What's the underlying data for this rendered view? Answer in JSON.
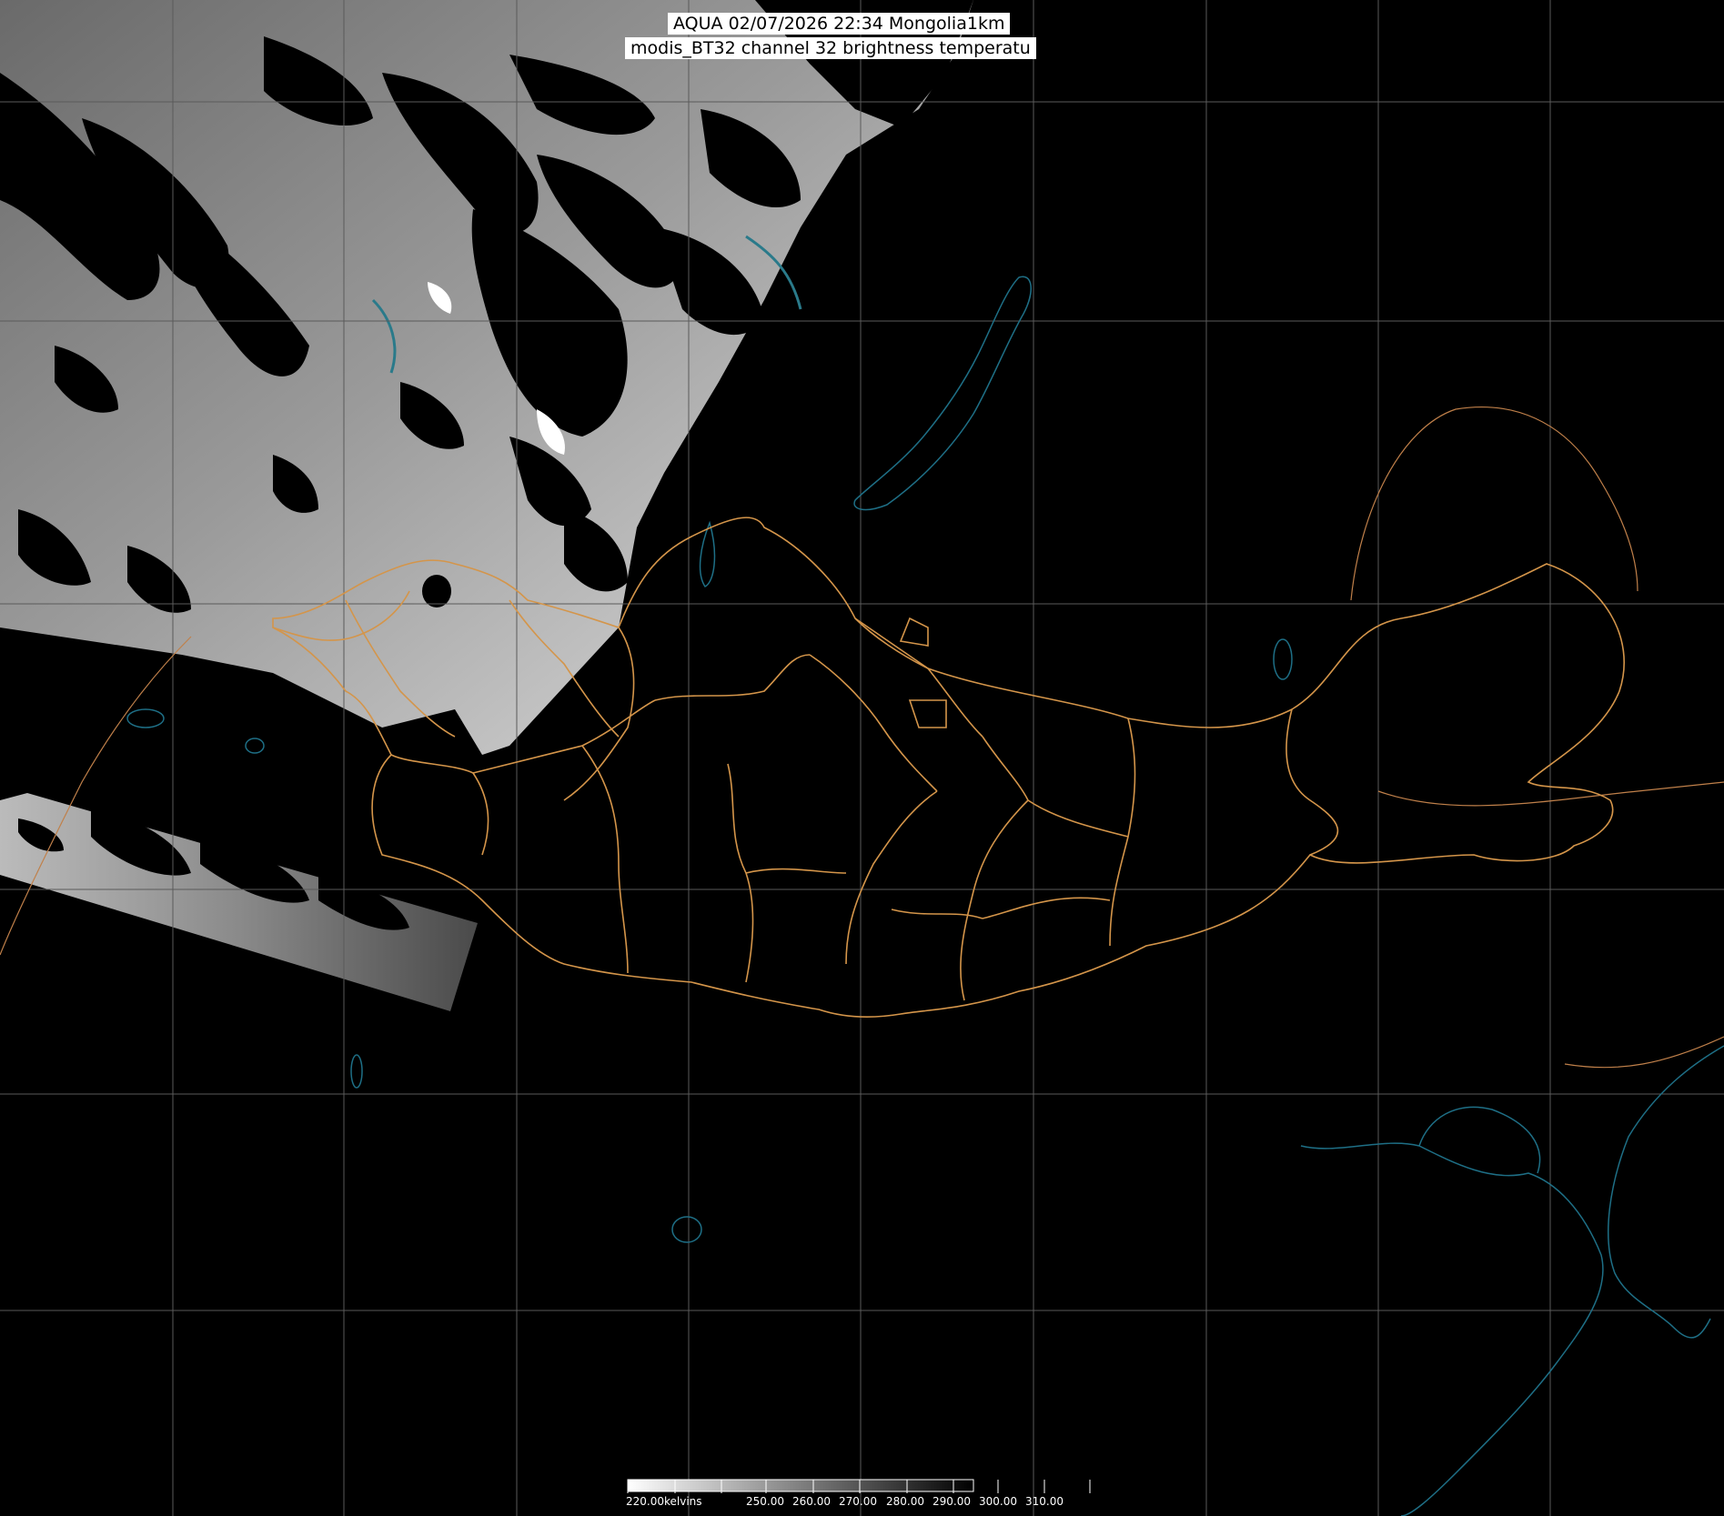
{
  "title": {
    "line1": "AQUA 02/07/2026 22:34 Mongolia1km",
    "line2": "modis_BT32 channel 32 brightness temperatu"
  },
  "colorbar": {
    "unit": "kelvins",
    "min_label": "220.00kelvins",
    "ticks": [
      "250.00",
      "260.00",
      "270.00",
      "280.00",
      "290.00",
      "300.00",
      "310.00"
    ],
    "range": [
      220,
      320
    ],
    "gradient": "white-to-black"
  },
  "colors": {
    "background": "#000000",
    "graticule": "#5a5a5a",
    "coastline": "#1e6f86",
    "admin_boundary": "#d4954a",
    "title_bg": "#ffffff",
    "title_text": "#000000"
  },
  "map": {
    "region": "Mongolia",
    "grid": true
  }
}
